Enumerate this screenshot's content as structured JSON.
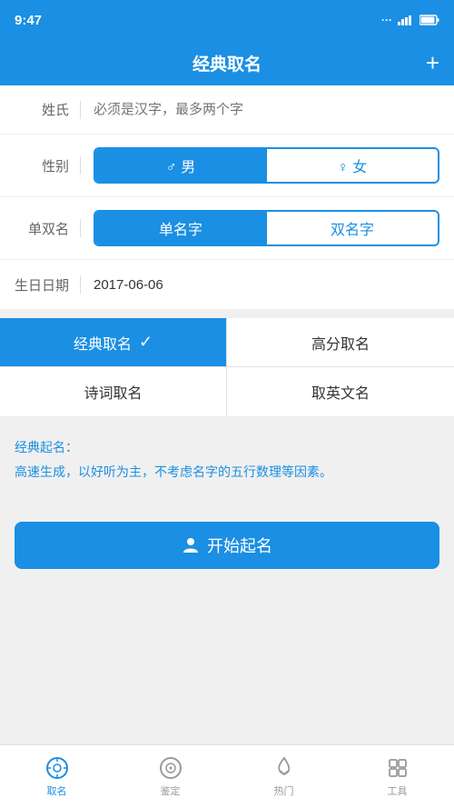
{
  "statusBar": {
    "time": "9:47",
    "dots": "···",
    "signal": "..ll",
    "battery": "□"
  },
  "header": {
    "title": "经典取名",
    "addIcon": "+"
  },
  "form": {
    "lastNameLabel": "姓氏",
    "lastNamePlaceholder": "必须是汉字，最多两个字",
    "genderLabel": "性别",
    "genderMale": "♂ 男",
    "genderFemale": "♀ 女",
    "nameTypeLabel": "单双名",
    "nameSingle": "单名字",
    "nameDouble": "双名字",
    "birthdayLabel": "生日日期",
    "birthdayValue": "2017-06-06"
  },
  "nameTypes": [
    {
      "id": "classic",
      "label": "经典取名",
      "active": true,
      "hasCheck": true
    },
    {
      "id": "highscore",
      "label": "高分取名",
      "active": false,
      "hasCheck": false
    },
    {
      "id": "poetry",
      "label": "诗词取名",
      "active": false,
      "hasCheck": false
    },
    {
      "id": "english",
      "label": "取英文名",
      "active": false,
      "hasCheck": false
    }
  ],
  "description": {
    "title": "经典起名：",
    "text": "高速生成，以好听为主，不考虑名字的五行数理等因素。"
  },
  "startButton": {
    "icon": "👤",
    "label": "开始起名"
  },
  "bottomNav": {
    "items": [
      {
        "id": "naming",
        "icon": "⚙",
        "label": "取名",
        "active": true
      },
      {
        "id": "appraise",
        "icon": "◎",
        "label": "鉴定",
        "active": false
      },
      {
        "id": "hot",
        "icon": "🔥",
        "label": "热门",
        "active": false
      },
      {
        "id": "tools",
        "icon": "🔧",
        "label": "工具",
        "active": false
      }
    ]
  }
}
